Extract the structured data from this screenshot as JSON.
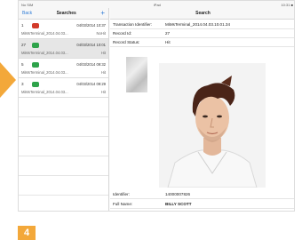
{
  "status_bar": {
    "left": "No SIM",
    "center": "iPad",
    "right": "10:31 ■"
  },
  "left_nav": {
    "back_label": "Back",
    "title": "Searches",
    "add_label": "+"
  },
  "entries": [
    {
      "index": "1",
      "rating": "down",
      "timestamp": "04/03/2014 10:37",
      "source": "MiMsTerminal_2014.04.03...",
      "status": "NoHit"
    },
    {
      "index": "27",
      "rating": "up",
      "timestamp": "04/03/2014 10:01",
      "source": "MiMsTerminal_2014.04.03...",
      "status": "Hit"
    },
    {
      "index": "5",
      "rating": "up",
      "timestamp": "04/03/2014 09:32",
      "source": "MiMsTerminal_2014.04.03...",
      "status": "Hit"
    },
    {
      "index": "3",
      "rating": "up",
      "timestamp": "04/03/2014 09:29",
      "source": "MiMsTerminal_2014.04.03...",
      "status": "Hit"
    }
  ],
  "right_nav": {
    "title": "Search"
  },
  "details": {
    "transaction_label": "Transaction Identifier:",
    "transaction_value": "MiMsTerminal_2014.04.03.10.01.34",
    "record_id_label": "Record Id:",
    "record_id_value": "27",
    "record_status_label": "Record Status:",
    "record_status_value": "Hit",
    "identifier_label": "Identifier:",
    "identifier_value": "14000007826",
    "full_name_label": "Full Name:",
    "full_name_value": "BILLY SCOTT"
  },
  "step_number": "4",
  "colors": {
    "accent_orange": "#f3a83a",
    "link_blue": "#2e7bd6",
    "thumb_down": "#d23a2a",
    "thumb_up": "#2ea34a"
  }
}
